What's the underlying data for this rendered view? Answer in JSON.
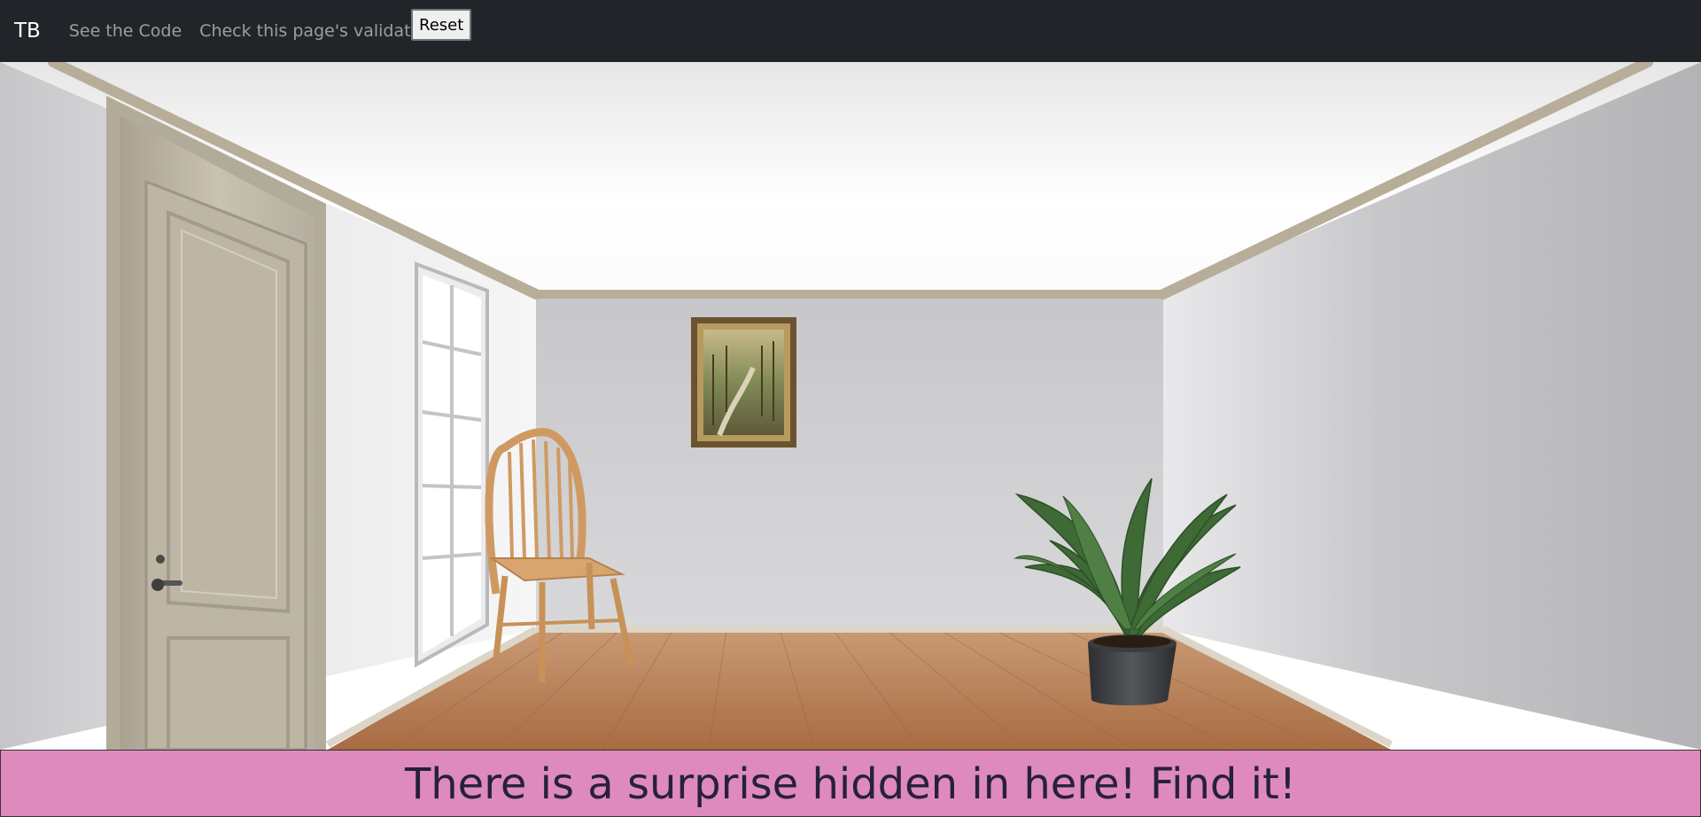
{
  "navbar": {
    "brand": "TB",
    "links": [
      "See the Code",
      "Check this page's validation"
    ],
    "reset_label": "Reset"
  },
  "scene": {
    "objects": [
      "door",
      "window",
      "chair",
      "painting",
      "plant"
    ]
  },
  "banner": {
    "text": "There is a surprise hidden in here! Find it!",
    "background": "#df8abd"
  },
  "colors": {
    "navbar_bg": "#212529",
    "floor": "#b97d52",
    "walls": "#cfcfd1"
  }
}
